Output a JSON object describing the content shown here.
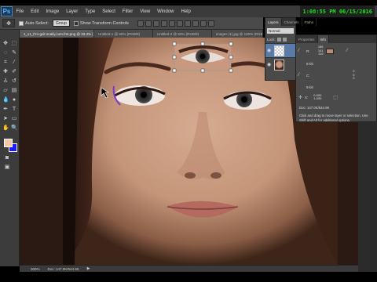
{
  "app": {
    "logo": "Ps",
    "clock": "1:08:55 PM 06/15/2016"
  },
  "menu": [
    "File",
    "Edit",
    "Image",
    "Layer",
    "Type",
    "Select",
    "Filter",
    "View",
    "Window",
    "Help"
  ],
  "options": {
    "tool_glyph": "✥",
    "auto_select_label": "Auto-Select:",
    "auto_select_value": "Group",
    "transform_label": "Show Transform Controls",
    "align_buttons": 10
  },
  "doc_tabs": [
    "1_x1_Fro-gvit-snaily.com.fmt.png @ 33.3% (RGB/8)",
    "Untitled-1 @ 50% (RGB/8)",
    "Untitled-2 @ 50% (RGB/8)",
    "images (1).jpg @ 100% (RGB/8)"
  ],
  "status": {
    "zoom": "300%",
    "doc": "Doc: 147.0K/544.9K"
  },
  "layers_panel": {
    "tabs": [
      "Layers",
      "Channels",
      "Paths"
    ],
    "blend_mode": "Normal",
    "lock_label": "Lock:",
    "layers": [
      {
        "name": "Layer 1",
        "thumb": "checker",
        "selected": true
      },
      {
        "name": "Background",
        "thumb": "face",
        "selected": false
      }
    ]
  },
  "properties_panel": {
    "tabs": [
      "Properties",
      "Info"
    ],
    "rows": [
      {
        "left_label": "R:",
        "left_values": [
          "186",
          "141",
          "119"
        ],
        "right_values": [
          "",
          "",
          ""
        ],
        "swatch": "#ba8d77"
      },
      {
        "left_label": "8-bit",
        "left_values": [],
        "right_values": [],
        "swatch": ""
      },
      {
        "left_label": "C:",
        "left_values": [
          "",
          "",
          ""
        ],
        "right_values": [
          "0",
          "0",
          "0"
        ],
        "swatch": "#ffffff"
      },
      {
        "left_label": "8-bit",
        "left_values": [],
        "right_values": [],
        "swatch": ""
      },
      {
        "left_label": "X:",
        "left_values": [
          "0.000",
          "1.000"
        ],
        "right_values": [
          "W:",
          "H:"
        ],
        "swatch": ""
      }
    ],
    "doc": "Doc: 147.0K/544.9K",
    "hint": "Click and drag to move layer or selection. Use Shift and Alt for additional options."
  },
  "colors": {
    "foreground": "#f3c7a8",
    "background": "#1a1aff",
    "marker": "#7a3cc8"
  }
}
